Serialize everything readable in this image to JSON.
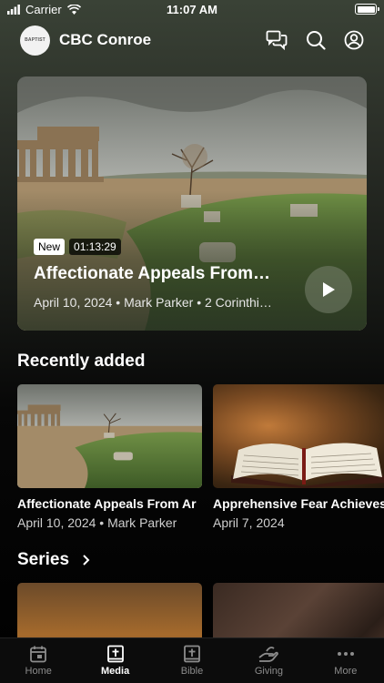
{
  "status_bar": {
    "carrier": "Carrier",
    "time": "11:07 AM"
  },
  "header": {
    "logo_text": "BAPTIST",
    "org_name": "CBC Conroe",
    "icons": [
      "chat-icon",
      "search-icon",
      "profile-icon"
    ]
  },
  "hero": {
    "badge_new": "New",
    "duration": "01:13:29",
    "title": "Affectionate Appeals From…",
    "meta": "April 10, 2024 • Mark Parker • 2 Corinthi…"
  },
  "recently_added": {
    "title": "Recently added",
    "items": [
      {
        "title": "Affectionate Appeals From Ar",
        "meta": "April 10, 2024 • Mark Parker"
      },
      {
        "title": "Apprehensive Fear Achieves",
        "meta": "April 7, 2024"
      }
    ]
  },
  "series": {
    "title": "Series"
  },
  "tabbar": {
    "items": [
      {
        "label": "Home",
        "icon": "calendar-icon"
      },
      {
        "label": "Media",
        "icon": "media-book-icon",
        "active": true
      },
      {
        "label": "Bible",
        "icon": "bible-icon"
      },
      {
        "label": "Giving",
        "icon": "giving-hand-icon"
      },
      {
        "label": "More",
        "icon": "more-dots-icon"
      }
    ]
  }
}
